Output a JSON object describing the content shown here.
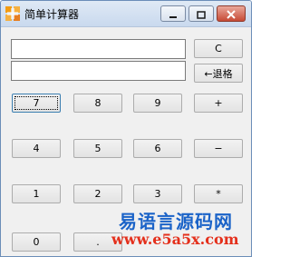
{
  "window": {
    "title": "简单计算器",
    "icon": "calculator-plus-icon",
    "controls": [
      "minimize-icon",
      "maximize-icon",
      "close-icon"
    ]
  },
  "display": {
    "expression_value": "",
    "result_value": ""
  },
  "buttons": {
    "clear": "C",
    "backspace": "←退格",
    "n7": "7",
    "n8": "8",
    "n9": "9",
    "plus": "+",
    "n4": "4",
    "n5": "5",
    "n6": "6",
    "minus": "−",
    "n1": "1",
    "n2": "2",
    "n3": "3",
    "multiply": "*",
    "n0": "0",
    "dot": "."
  },
  "watermark": {
    "name": "易语言源码网",
    "url": "www.e5a5x.com"
  },
  "colors": {
    "watermark_name": "#1b63c8",
    "watermark_url": "#e4301c",
    "window_border": "#6b8db8"
  }
}
